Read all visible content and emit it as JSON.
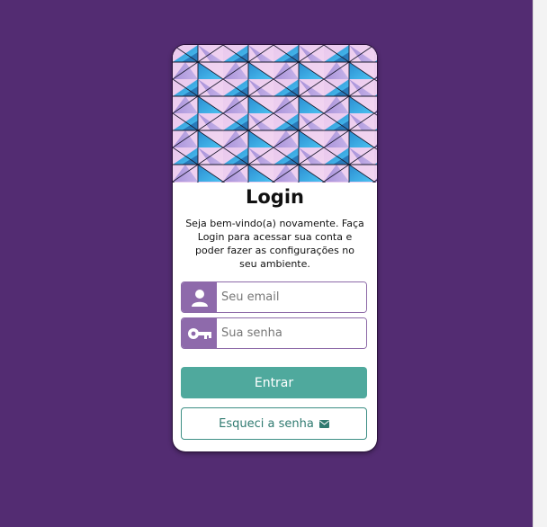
{
  "login": {
    "title": "Login",
    "description": "Seja bem-vindo(a) novamente. Faça Login para acessar sua conta e poder fazer as configurações no seu ambiente.",
    "email_placeholder": "Seu email",
    "password_placeholder": "Sua senha",
    "submit_label": "Entrar",
    "forgot_label": "Esqueci a senha"
  },
  "icons": {
    "email_field": "user-icon",
    "password_field": "key-icon",
    "forgot": "envelope-icon"
  },
  "colors": {
    "background": "#532c72",
    "icon_box": "#8e6aab",
    "primary_button": "#4fa99d",
    "secondary_text": "#2f7a70"
  }
}
